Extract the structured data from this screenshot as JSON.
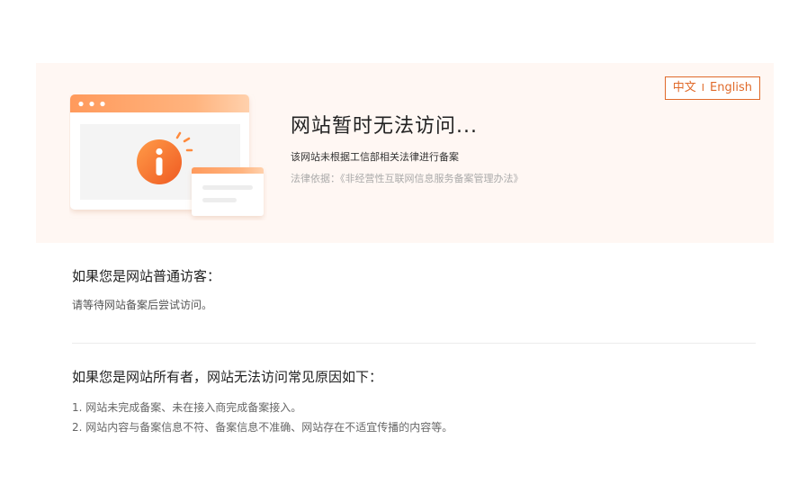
{
  "header": {
    "lang_zh": "中文",
    "lang_sep": "I",
    "lang_en": "English",
    "title": "网站暂时无法访问...",
    "description": "该网站未根据工信部相关法律进行备案",
    "basis": "法律依据：《非经营性互联网信息服务备案管理办法》"
  },
  "visitor": {
    "title": "如果您是网站普通访客：",
    "text": "请等待网站备案后尝试访问。"
  },
  "owner": {
    "title": "如果您是网站所有者，网站无法访问常见原因如下：",
    "reasons": [
      "1. 网站未完成备案、未在接入商完成备案接入。",
      "2. 网站内容与备案信息不符、备案信息不准确、网站存在不适宜传播的内容等。"
    ]
  },
  "colors": {
    "accent": "#f07a3a",
    "accent_light": "#ffc9a3",
    "banner_bg": "#fff7f3"
  },
  "icons": {
    "info": "info-icon",
    "browser": "browser-window-illustration"
  }
}
